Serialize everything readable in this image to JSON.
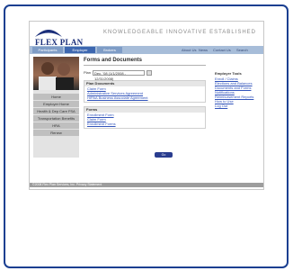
{
  "brand": {
    "name": "FLEX PLAN",
    "tagline": "KNOWLEDGEABLE  INNOVATIVE  ESTABLISHED"
  },
  "colors": {
    "frame": "#1a3f91",
    "nav": "#a7bdd9",
    "nav_active": "#3d67b0",
    "button": "#2a3d8f",
    "link": "#3355bb"
  },
  "nav": {
    "tabs": [
      "Participants",
      "Employer",
      "Brokers"
    ],
    "utility": [
      "About Us",
      "News",
      "Contact Us",
      "Search"
    ]
  },
  "sidebar": {
    "items": [
      "Home",
      "Employer Home",
      "Health & Dep Care FSA",
      "Transportation Benefits",
      "HRA",
      "Renew"
    ]
  },
  "main": {
    "title": "Forms and Documents",
    "filter_label": "Plan",
    "filter_value": "Dec. '08 (1/1/2008 - 12/31/2008)",
    "plan_docs": {
      "heading": "Plan Documents",
      "links": [
        "Claim Form",
        "Administrative Services Agreement",
        "HIPAA Business Associate Agreement"
      ]
    },
    "forms": {
      "heading": "Forms",
      "links": [
        "Enrollment Form",
        "Claim Form",
        "Enrollment Forms"
      ]
    },
    "button_label": "Go"
  },
  "tools": {
    "heading": "Employer Tools",
    "links": [
      "Enroll / Claims",
      "Elections and Balances",
      "Documents and Forms",
      "Notifications",
      "Reimbursement Reports",
      "How to Use",
      "Log Out"
    ]
  },
  "footer": {
    "text": "©2008 Flex Plan Services, Inc.   Privacy Statement"
  }
}
